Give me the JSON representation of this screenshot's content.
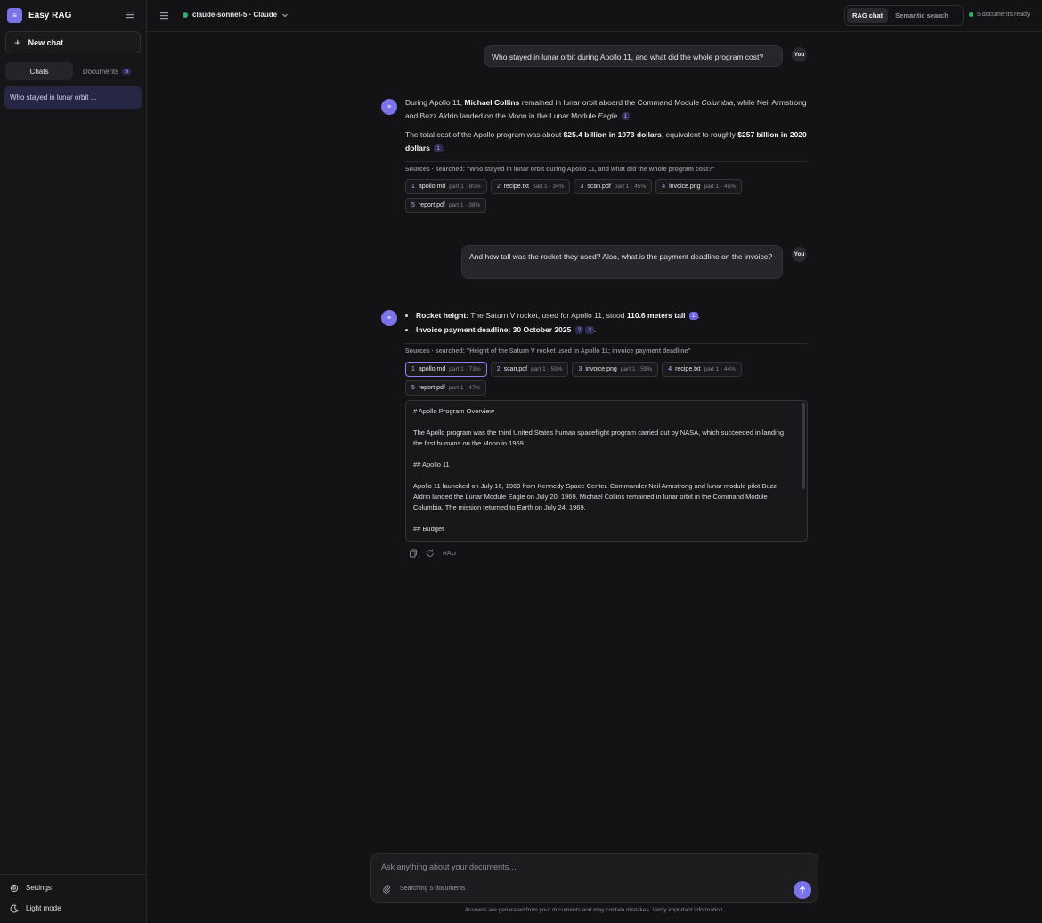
{
  "app": {
    "name": "Easy RAG",
    "logo_glyph": "≡",
    "accent": "#7b73e8"
  },
  "sidebar": {
    "new_chat": "New chat",
    "tabs": {
      "chats": "Chats",
      "documents": "Documents",
      "documents_count": "5"
    },
    "chat_items": [
      "Who stayed in lunar orbit ..."
    ],
    "bottom": {
      "settings": "Settings",
      "theme": "Light mode"
    }
  },
  "header": {
    "model": "claude-sonnet-5 · Claude",
    "modes": {
      "rag": "RAG chat",
      "semantic": "Semantic search"
    },
    "status": "5 documents ready"
  },
  "conversation": {
    "user_label": "You",
    "assistant_glyph": "≡",
    "q1": "Who stayed in lunar orbit during Apollo 11, and what did the whole program cost?",
    "a1": {
      "p1": {
        "t1": "During Apollo 11, ",
        "b1": "Michael Collins",
        "t2": " remained in lunar orbit aboard the Command Module ",
        "i1": "Columbia",
        "t3": ", while Neil Armstrong and Buzz Aldrin landed on the Moon in the Lunar Module ",
        "i2": "Eagle",
        "c1": "1",
        "t4": "."
      },
      "p2": {
        "t1": "The total cost of the Apollo program was about ",
        "b1": "$25.4 billion in 1973 dollars",
        "t2": ", equivalent to roughly ",
        "b2": "$257 billion in 2020 dollars",
        "c1": "1",
        "t3": "."
      }
    },
    "sources1": {
      "label": "Sources",
      "searched": "· searched: \"Who stayed in lunar orbit during Apollo 11, and what did the whole program cost?\"",
      "chips": [
        {
          "n": "1",
          "file": "apollo.md",
          "meta": "part 1 · 80%"
        },
        {
          "n": "2",
          "file": "recipe.txt",
          "meta": "part 1 · 34%"
        },
        {
          "n": "3",
          "file": "scan.pdf",
          "meta": "part 1 · 45%"
        },
        {
          "n": "4",
          "file": "invoice.png",
          "meta": "part 1 · 45%"
        },
        {
          "n": "5",
          "file": "report.pdf",
          "meta": "part 1 · 38%"
        }
      ]
    },
    "q2": "And how tall was the rocket they used? Also, what is the payment deadline on the invoice?",
    "a2": {
      "li1": {
        "b1": "Rocket height:",
        "t1": " The Saturn V rocket, used for Apollo 11, stood ",
        "b2": "110.6 meters tall",
        "c1": "1",
        "t2": "."
      },
      "li2": {
        "b1": "Invoice payment deadline: 30 October 2025",
        "c1": "2",
        "c2": "3",
        "t1": "."
      }
    },
    "sources2": {
      "label": "Sources",
      "searched": "· searched: \"Height of the Saturn V rocket used in Apollo 11; invoice payment deadline\"",
      "chips": [
        {
          "n": "1",
          "file": "apollo.md",
          "meta": "part 1 · 73%"
        },
        {
          "n": "2",
          "file": "scan.pdf",
          "meta": "part 1 · 59%"
        },
        {
          "n": "3",
          "file": "invoice.png",
          "meta": "part 1 · 59%"
        },
        {
          "n": "4",
          "file": "recipe.txt",
          "meta": "part 1 · 44%"
        },
        {
          "n": "5",
          "file": "report.pdf",
          "meta": "part 1 · 47%"
        }
      ]
    },
    "preview": {
      "h1": "# Apollo Program Overview",
      "p1": "The Apollo program was the third United States human spaceflight program carried out by NASA, which succeeded in landing the first humans on the Moon in 1969.",
      "h2": "## Apollo 11",
      "p2": "Apollo 11 launched on July 16, 1969 from Kennedy Space Center. Commander Neil Armstrong and lunar module pilot Buzz Aldrin landed the Lunar Module Eagle on July 20, 1969. Michael Collins remained in lunar orbit in the Command Module Columbia. The mission returned to Earth on July 24, 1969.",
      "h3": "## Budget"
    },
    "action_tag": "RAG"
  },
  "composer": {
    "placeholder": "Ask anything about your documents…",
    "status": "Searching 5 documents",
    "disclaimer": "Answers are generated from your documents and may contain mistakes. Verify important information."
  }
}
